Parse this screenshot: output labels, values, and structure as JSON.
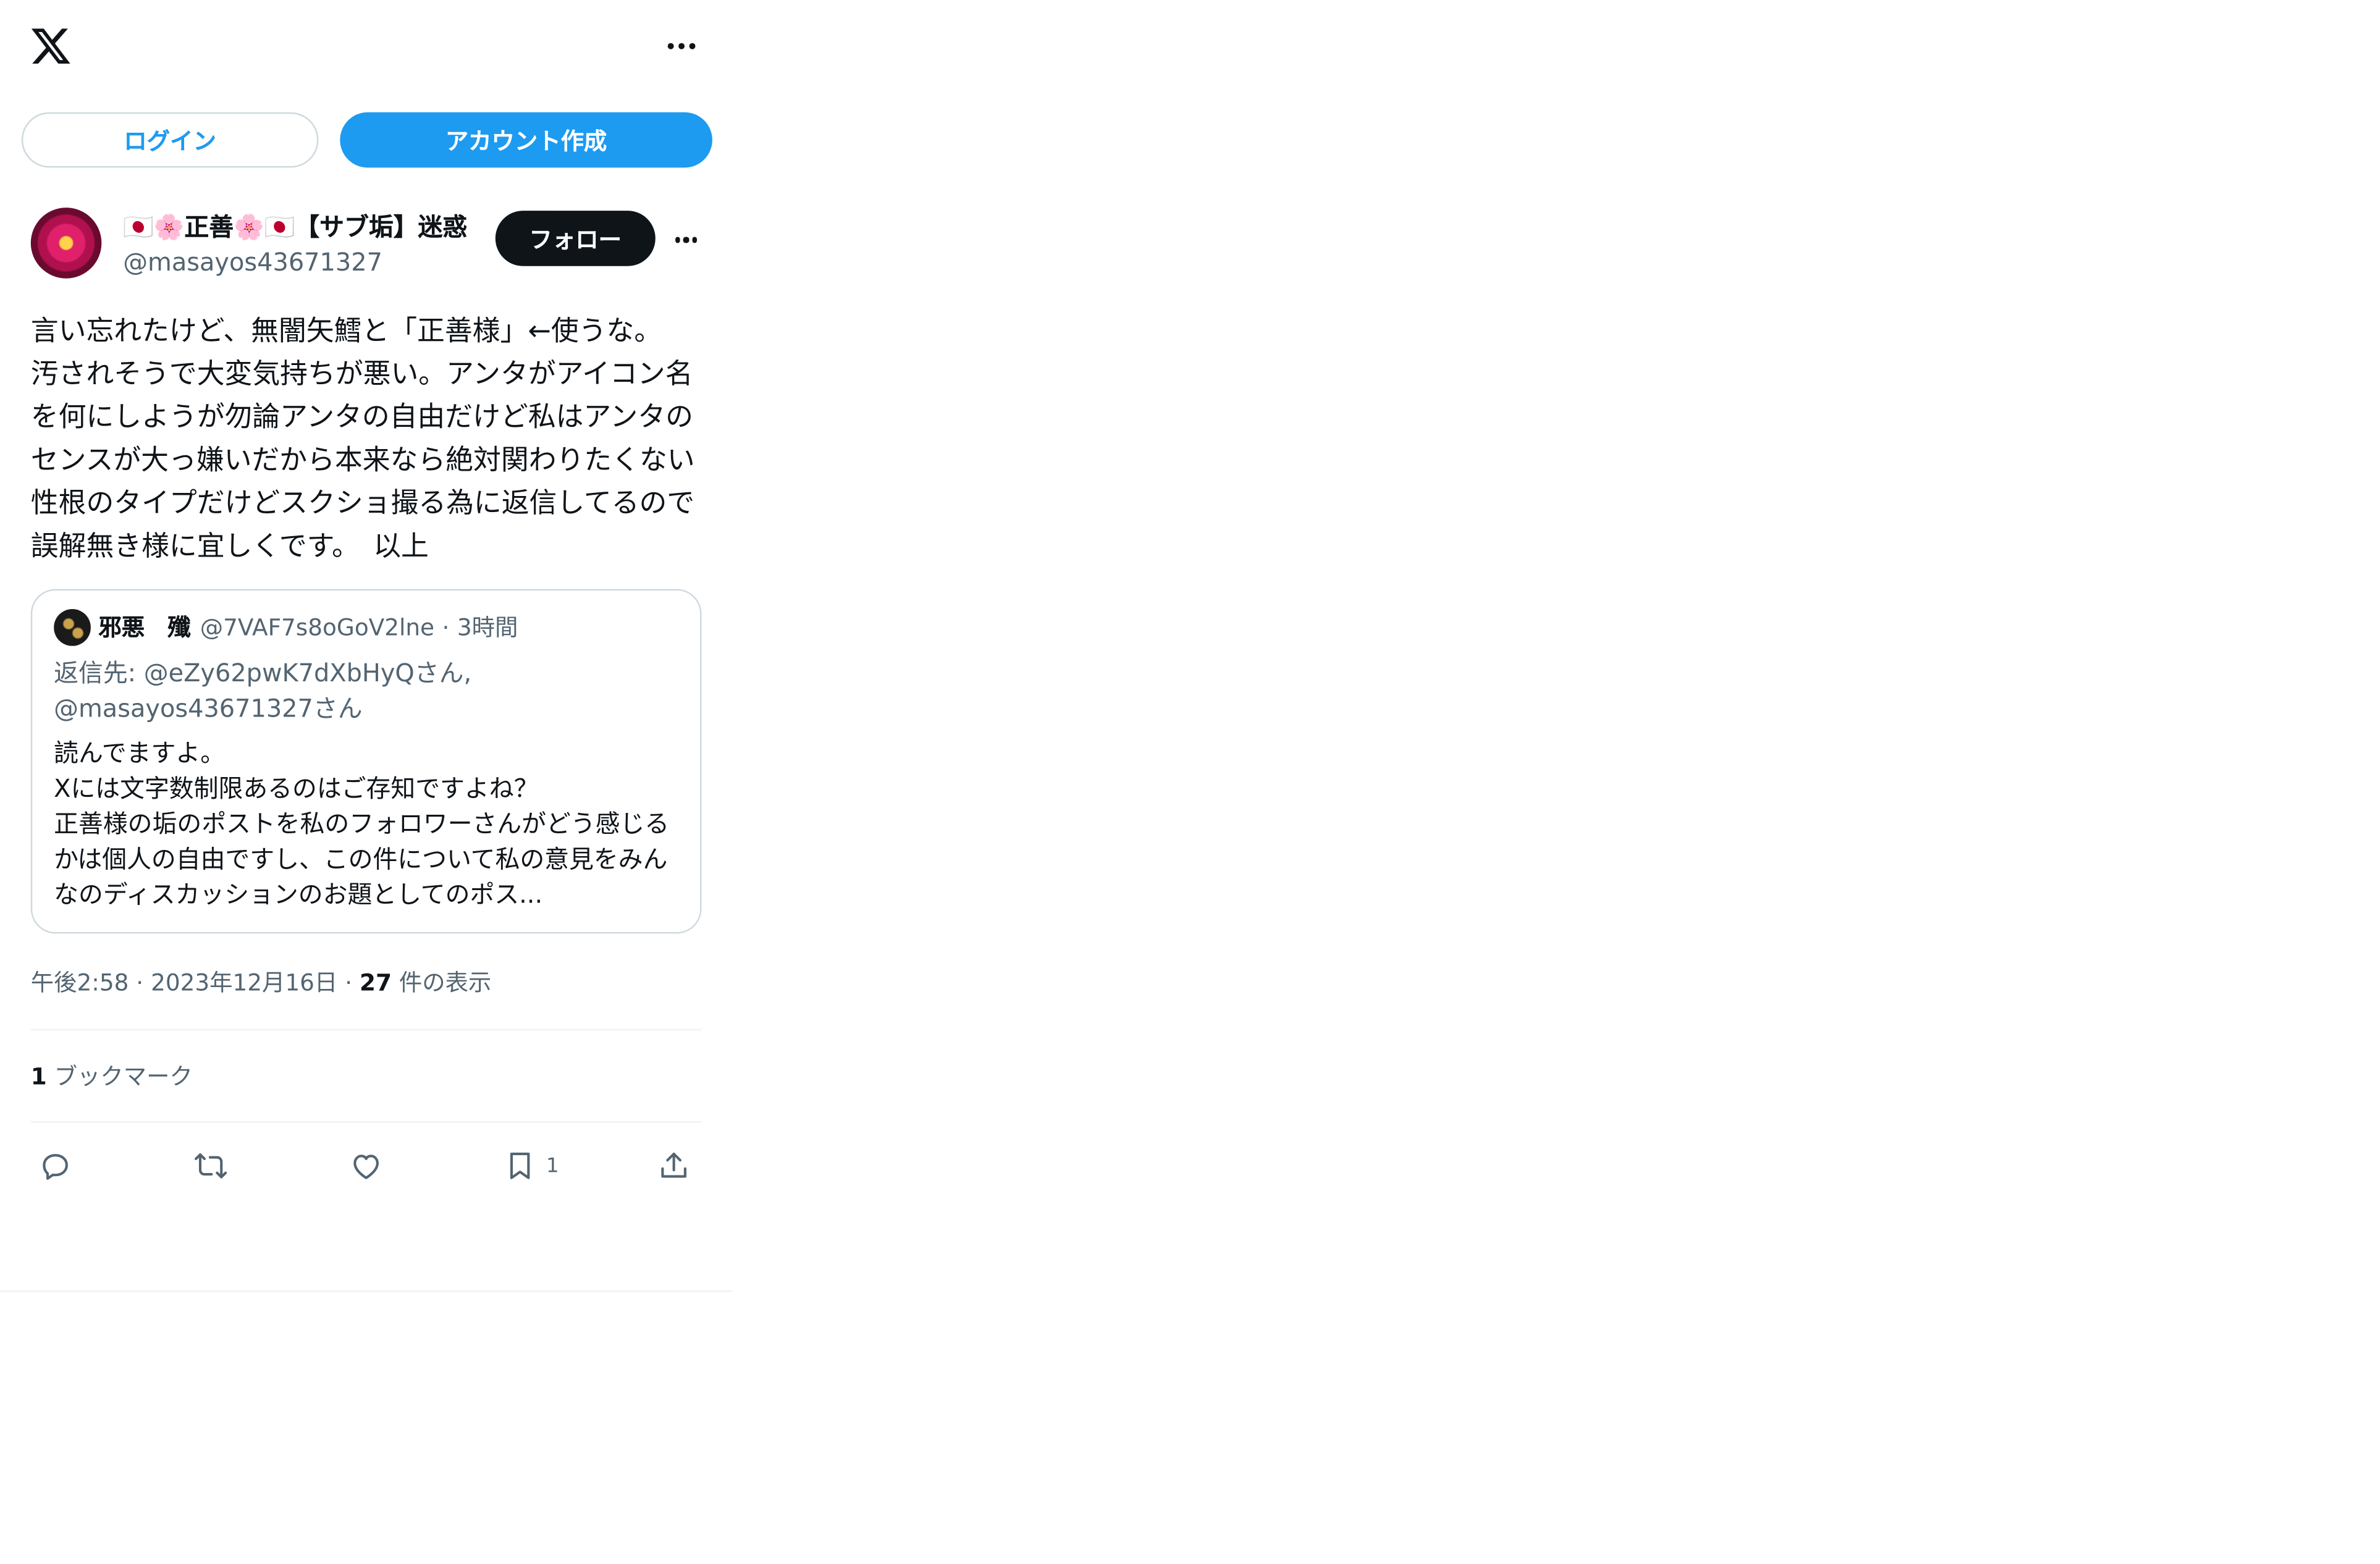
{
  "header": {
    "logo_icon": "x-logo-icon",
    "more_icon": "more-horizontal-icon"
  },
  "auth": {
    "login_label": "ログイン",
    "signup_label": "アカウント作成"
  },
  "post": {
    "author_name": "🇯🇵🌸正善🌸🇯🇵【サブ垢】迷惑",
    "author_handle": "@masayos43671327",
    "follow_label": "フォロー",
    "text": "言い忘れたけど、無闇矢鱈と「正善様」←使うな。\n汚されそうで大変気持ちが悪い。アンタがアイコン名を何にしようが勿論アンタの自由だけど私はアンタのセンスが大っ嫌いだから本来なら絶対関わりたくない性根のタイプだけどスクショ撮る為に返信してるので誤解無き様に宜しくです。　以上",
    "quote": {
      "name": "邪悪　殲",
      "handle": "@7VAF7s8oGoV2lne",
      "separator": "·",
      "time": "3時間",
      "reply_to": "返信先: @eZy62pwK7dXbHyQさん, @masayos43671327さん",
      "text": "読んでますよ。\nXには文字数制限あるのはご存知ですよね？\n正善様の垢のポストを私のフォロワーさんがどう感じるかは個人の自由ですし、この件について私の意見をみんなのディスカッションのお題としてのポス..."
    },
    "meta": {
      "time": "午後2:58",
      "separator": "·",
      "date": "2023年12月16日",
      "views_count": "27",
      "views_label": "件の表示"
    },
    "bookmarks": {
      "count": "1",
      "label": "ブックマーク"
    },
    "actions": {
      "reply_icon": "reply-icon",
      "repost_icon": "repost-icon",
      "like_icon": "heart-icon",
      "bookmark_icon": "bookmark-icon",
      "bookmark_count": "1",
      "share_icon": "share-icon"
    }
  },
  "colors": {
    "accent": "#1d9bf0",
    "text": "#0f1419",
    "secondary": "#536471",
    "border": "#cfd9de"
  }
}
